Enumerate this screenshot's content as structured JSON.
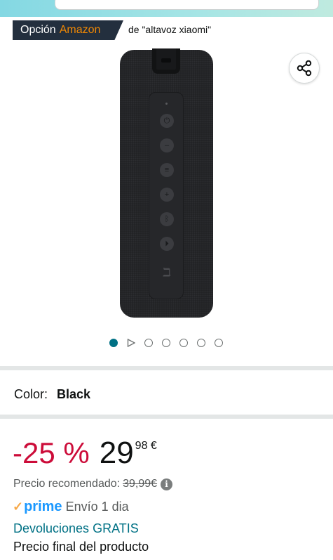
{
  "choice": {
    "word": "Opción",
    "brand": "Amazon",
    "query": "de \"altavoz xiaomi\""
  },
  "icons": {
    "share": "share-icon",
    "info": "info-icon",
    "video": "play-triangle-icon"
  },
  "carousel": {
    "active_index": 0,
    "count": 7
  },
  "color": {
    "label": "Color:",
    "value": "Black"
  },
  "price": {
    "discount": "-25 %",
    "whole": "29",
    "fraction": "98 €",
    "rrp_label": "Precio recomendado:",
    "rrp_value": "39,99€"
  },
  "prime": {
    "logo": "prime",
    "delivery": "Envío 1 dia"
  },
  "returns": "Devoluciones GRATIS",
  "final_price": "Precio final del producto",
  "colors": {
    "accent_teal": "#007185",
    "discount_red": "#cc0c39",
    "prime_blue": "#1a98ff",
    "badge_navy": "#232f3e",
    "amazon_orange": "#f08804"
  }
}
